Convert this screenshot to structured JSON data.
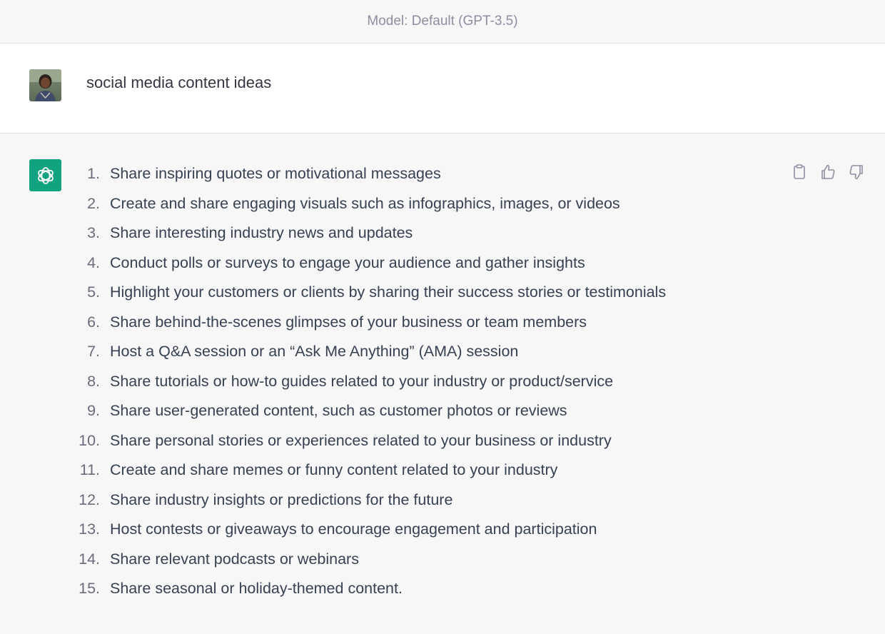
{
  "header": {
    "model_label": "Model: Default (GPT-3.5)"
  },
  "user_message": {
    "text": "social media content ideas"
  },
  "assistant_message": {
    "items": [
      {
        "num": "1.",
        "text": "Share inspiring quotes or motivational messages"
      },
      {
        "num": "2.",
        "text": "Create and share engaging visuals such as infographics, images, or videos"
      },
      {
        "num": "3.",
        "text": "Share interesting industry news and updates"
      },
      {
        "num": "4.",
        "text": "Conduct polls or surveys to engage your audience and gather insights"
      },
      {
        "num": "5.",
        "text": "Highlight your customers or clients by sharing their success stories or testimonials"
      },
      {
        "num": "6.",
        "text": "Share behind-the-scenes glimpses of your business or team members"
      },
      {
        "num": "7.",
        "text": "Host a Q&A session or an “Ask Me Anything” (AMA) session"
      },
      {
        "num": "8.",
        "text": "Share tutorials or how-to guides related to your industry or product/service"
      },
      {
        "num": "9.",
        "text": "Share user-generated content, such as customer photos or reviews"
      },
      {
        "num": "10.",
        "text": "Share personal stories or experiences related to your business or industry"
      },
      {
        "num": "11.",
        "text": "Create and share memes or funny content related to your industry"
      },
      {
        "num": "12.",
        "text": "Share industry insights or predictions for the future"
      },
      {
        "num": "13.",
        "text": "Host contests or giveaways to encourage engagement and participation"
      },
      {
        "num": "14.",
        "text": "Share relevant podcasts or webinars"
      },
      {
        "num": "15.",
        "text": "Share seasonal or holiday-themed content."
      }
    ]
  },
  "icons": {
    "copy": "clipboard-icon",
    "like": "thumbs-up-icon",
    "dislike": "thumbs-down-icon",
    "assistant_logo": "openai-logo-icon",
    "user_avatar": "user-avatar"
  },
  "colors": {
    "brand_green": "#10a37f",
    "header_bg": "#f7f7f8",
    "user_bg": "#ffffff",
    "assistant_bg": "#f7f7f8",
    "muted_text": "#8e8ea0"
  }
}
